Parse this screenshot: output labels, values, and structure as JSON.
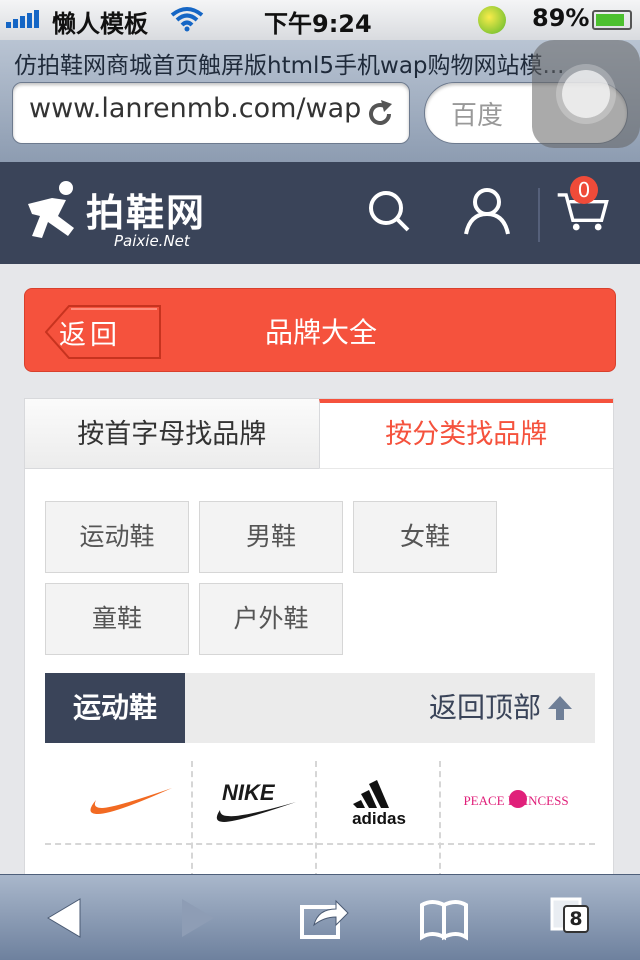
{
  "status_bar": {
    "carrier": "懒人模板",
    "time": "下午9:24",
    "battery": "89%",
    "battery_level": 0.89
  },
  "browser": {
    "page_title": "仿拍鞋网商城首页触屏版html5手机wap购物网站模...",
    "url": "www.lanrenmb.com/wap",
    "search_placeholder": "百度"
  },
  "site": {
    "logo_text": "拍鞋网",
    "logo_sub": "Paixie.Net",
    "cart_count": "0",
    "icons": [
      "search-icon",
      "user-icon",
      "cart-icon"
    ]
  },
  "page": {
    "back_label": "返回",
    "title": "品牌大全"
  },
  "tabs": [
    {
      "label": "按首字母找品牌",
      "active": false
    },
    {
      "label": "按分类找品牌",
      "active": true
    }
  ],
  "categories": [
    "运动鞋",
    "男鞋",
    "女鞋",
    "童鞋",
    "户外鞋"
  ],
  "section": {
    "label": "运动鞋",
    "back_top": "返回顶部"
  },
  "brands": [
    {
      "name": "nike-swoosh"
    },
    {
      "name": "NIKE"
    },
    {
      "name": "adidas"
    },
    {
      "name": "PEACE PRINCESS"
    }
  ],
  "toolbar": {
    "tab_count": "8"
  },
  "colors": {
    "accent": "#f5523d",
    "header_bg": "#3a4459"
  }
}
